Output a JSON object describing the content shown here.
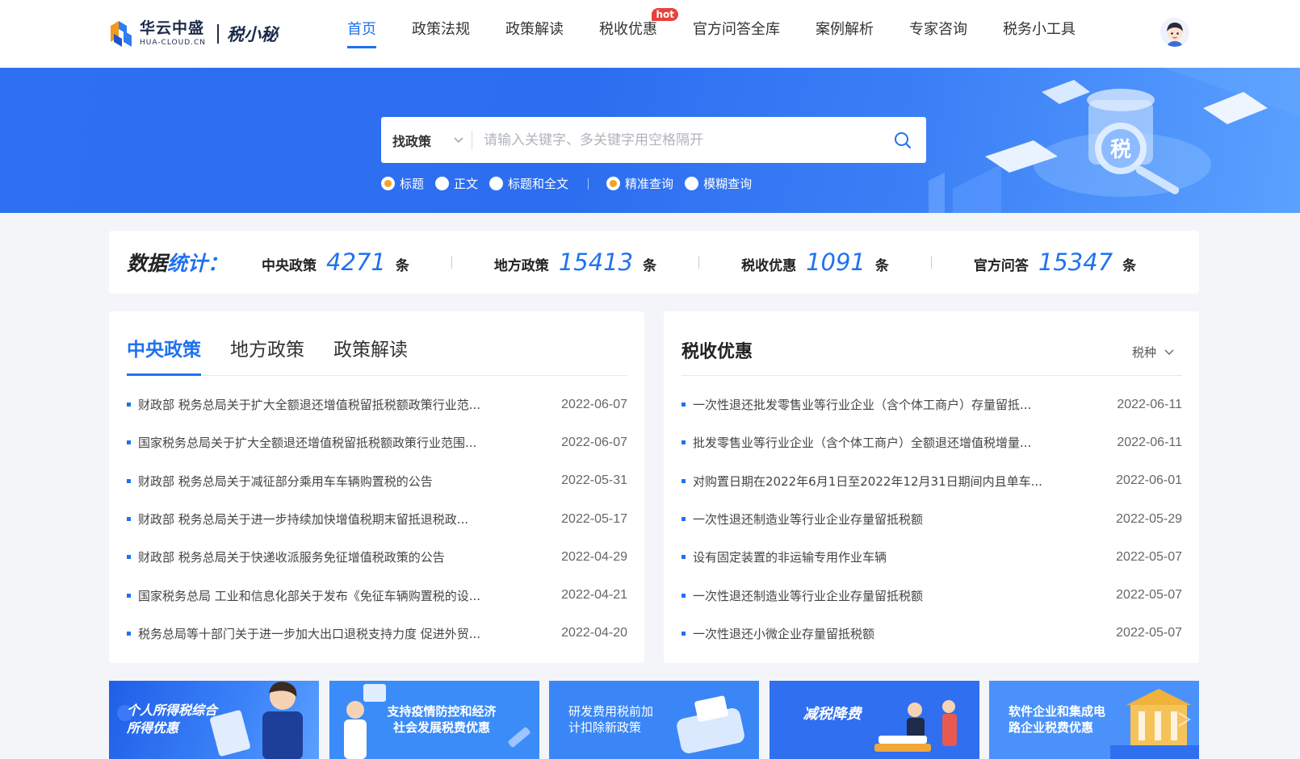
{
  "header": {
    "logo_cn": "华云中盛",
    "logo_en": "HUA-CLOUD.CN",
    "product": "税小秘",
    "nav": [
      {
        "label": "首页",
        "active": true
      },
      {
        "label": "政策法规"
      },
      {
        "label": "政策解读"
      },
      {
        "label": "税收优惠",
        "badge": "hot"
      },
      {
        "label": "官方问答全库"
      },
      {
        "label": "案例解析"
      },
      {
        "label": "专家咨询"
      },
      {
        "label": "税务小工具"
      }
    ]
  },
  "search": {
    "type_label": "找政策",
    "placeholder": "请输入关键字、多关键字用空格隔开",
    "scope_options": [
      {
        "label": "标题",
        "checked": true
      },
      {
        "label": "正文",
        "checked": false
      },
      {
        "label": "标题和全文",
        "checked": false
      }
    ],
    "mode_options": [
      {
        "label": "精准查询",
        "checked": true
      },
      {
        "label": "模糊查询",
        "checked": false
      }
    ]
  },
  "stats": {
    "title_a": "数据",
    "title_b": "统计：",
    "items": [
      {
        "label": "中央政策",
        "value": "4271",
        "unit": "条"
      },
      {
        "label": "地方政策",
        "value": "15413",
        "unit": "条"
      },
      {
        "label": "税收优惠",
        "value": "1091",
        "unit": "条"
      },
      {
        "label": "官方问答",
        "value": "15347",
        "unit": "条"
      }
    ]
  },
  "left_panel": {
    "tabs": [
      "中央政策",
      "地方政策",
      "政策解读"
    ],
    "items": [
      {
        "text": "财政部 税务总局关于扩大全额退还增值税留抵税额政策行业范...",
        "date": "2022-06-07"
      },
      {
        "text": "国家税务总局关于扩大全额退还增值税留抵税额政策行业范围...",
        "date": "2022-06-07"
      },
      {
        "text": "财政部 税务总局关于减征部分乘用车车辆购置税的公告",
        "date": "2022-05-31"
      },
      {
        "text": "财政部  税务总局关于进一步持续加快增值税期末留抵退税政...",
        "date": "2022-05-17"
      },
      {
        "text": "财政部 税务总局关于快递收派服务免征增值税政策的公告",
        "date": "2022-04-29"
      },
      {
        "text": "国家税务总局 工业和信息化部关于发布《免征车辆购置税的设...",
        "date": "2022-04-21"
      },
      {
        "text": "税务总局等十部门关于进一步加大出口退税支持力度 促进外贸...",
        "date": "2022-04-20"
      }
    ]
  },
  "right_panel": {
    "title": "税收优惠",
    "filter": "税种",
    "items": [
      {
        "text": "一次性退还批发零售业等行业企业（含个体工商户）存量留抵...",
        "date": "2022-06-11"
      },
      {
        "text": "批发零售业等行业企业（含个体工商户）全额退还增值税增量...",
        "date": "2022-06-11"
      },
      {
        "text": "对购置日期在2022年6月1日至2022年12月31日期间内且单车...",
        "date": "2022-06-01"
      },
      {
        "text": "一次性退还制造业等行业企业存量留抵税额",
        "date": "2022-05-29"
      },
      {
        "text": "设有固定装置的非运输专用作业车辆",
        "date": "2022-05-07"
      },
      {
        "text": "一次性退还制造业等行业企业存量留抵税额",
        "date": "2022-05-07"
      },
      {
        "text": "一次性退还小微企业存量留抵税额",
        "date": "2022-05-07"
      }
    ]
  },
  "cards": [
    {
      "line1": "个人所得税综合",
      "line2": "所得优惠"
    },
    {
      "line1": "支持疫情防控和经济",
      "line2": "社会发展税费优惠"
    },
    {
      "line1": "研发费用税前加",
      "line2": "计扣除新政策"
    },
    {
      "line1": "减税降费",
      "line2": ""
    },
    {
      "line1": "软件企业和集成电",
      "line2": "路企业税费优惠"
    }
  ]
}
